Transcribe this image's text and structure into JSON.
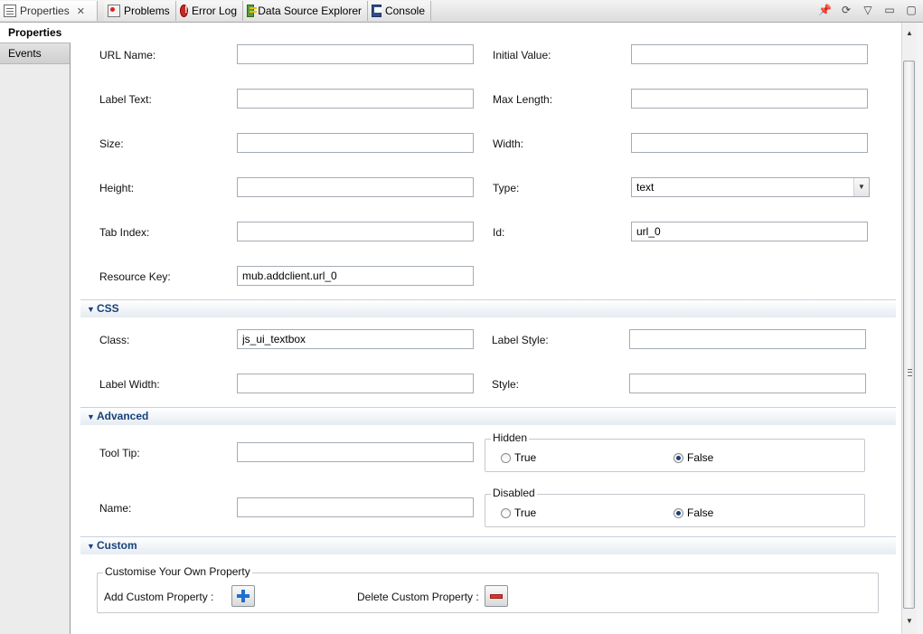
{
  "tabs": [
    {
      "label": "Properties",
      "icon": "properties-icon",
      "active": true,
      "close": "✕"
    },
    {
      "label": "Problems",
      "icon": "problems-icon"
    },
    {
      "label": "Error Log",
      "icon": "error-log-icon"
    },
    {
      "label": "Data Source Explorer",
      "icon": "data-source-explorer-icon"
    },
    {
      "label": "Console",
      "icon": "console-icon"
    }
  ],
  "nav": [
    "Properties",
    "Events"
  ],
  "general": {
    "url_name": {
      "label": "URL Name:",
      "value": ""
    },
    "initial_value": {
      "label": "Initial Value:",
      "value": ""
    },
    "label_text": {
      "label": "Label Text:",
      "value": ""
    },
    "max_length": {
      "label": "Max Length:",
      "value": ""
    },
    "size": {
      "label": "Size:",
      "value": ""
    },
    "width": {
      "label": "Width:",
      "value": ""
    },
    "height": {
      "label": "Height:",
      "value": ""
    },
    "type": {
      "label": "Type:",
      "value": "text"
    },
    "tab_index": {
      "label": "Tab Index:",
      "value": ""
    },
    "id": {
      "label": "Id:",
      "value": "url_0"
    },
    "resource_key": {
      "label": "Resource Key:",
      "value": "mub.addclient.url_0"
    }
  },
  "css": {
    "title": "CSS",
    "class": {
      "label": "Class:",
      "value": "js_ui_textbox"
    },
    "label_style": {
      "label": "Label Style:",
      "value": ""
    },
    "label_width": {
      "label": "Label Width:",
      "value": ""
    },
    "style": {
      "label": "Style:",
      "value": ""
    }
  },
  "advanced": {
    "title": "Advanced",
    "tool_tip": {
      "label": "Tool Tip:",
      "value": ""
    },
    "name": {
      "label": "Name:",
      "value": ""
    },
    "hidden": {
      "legend": "Hidden",
      "true_label": "True",
      "false_label": "False",
      "selected": "False"
    },
    "disabled": {
      "legend": "Disabled",
      "true_label": "True",
      "false_label": "False",
      "selected": "False"
    }
  },
  "custom": {
    "title": "Custom",
    "group_legend": "Customise Your Own Property",
    "add_label": "Add Custom Property :",
    "delete_label": "Delete Custom Property :"
  },
  "colors": {
    "section_title": "#17427a",
    "section_bg": "#e6ecf2"
  }
}
